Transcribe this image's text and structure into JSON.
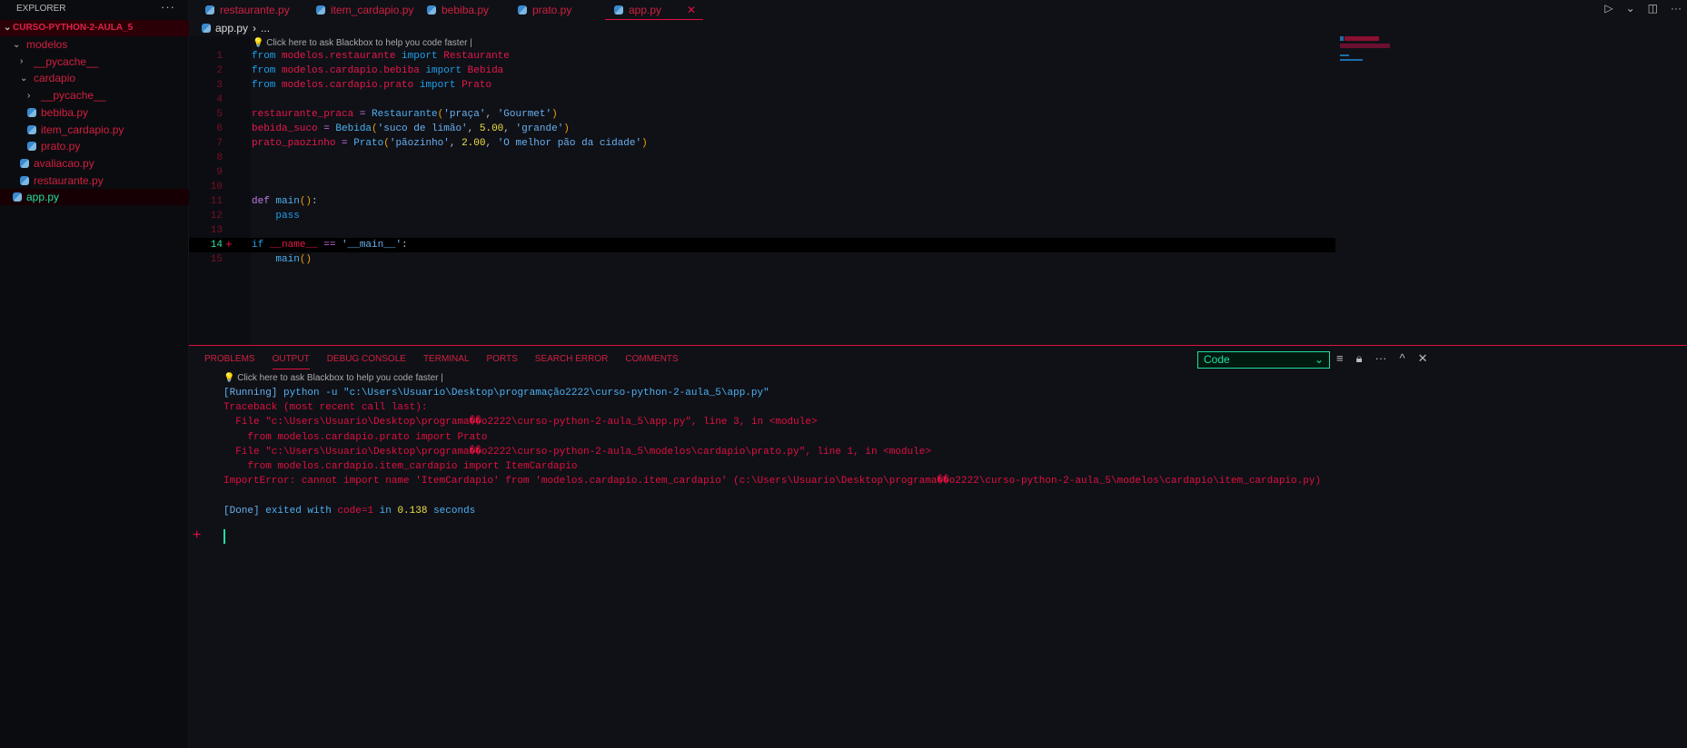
{
  "sidebar": {
    "title": "EXPLORER",
    "more": "···",
    "root": "CURSO-PYTHON-2-AULA_5",
    "items": [
      {
        "label": "modelos",
        "type": "folder-open",
        "depth": 1
      },
      {
        "label": "__pycache__",
        "type": "folder-closed",
        "depth": 2
      },
      {
        "label": "cardapio",
        "type": "folder-open",
        "depth": 2
      },
      {
        "label": "__pycache__",
        "type": "folder-closed",
        "depth": 3
      },
      {
        "label": "bebiba.py",
        "type": "file",
        "depth": 3
      },
      {
        "label": "item_cardapio.py",
        "type": "file",
        "depth": 3
      },
      {
        "label": "prato.py",
        "type": "file",
        "depth": 3
      },
      {
        "label": "avaliacao.py",
        "type": "file",
        "depth": 2
      },
      {
        "label": "restaurante.py",
        "type": "file",
        "depth": 2
      },
      {
        "label": "app.py",
        "type": "file",
        "depth": 1,
        "active": true
      }
    ]
  },
  "tabs": [
    {
      "label": "restaurante.py"
    },
    {
      "label": "item_cardapio.py"
    },
    {
      "label": "bebiba.py"
    },
    {
      "label": "prato.py"
    },
    {
      "label": "app.py",
      "active": true,
      "close": "✕"
    }
  ],
  "breadcrumb": {
    "file": "app.py",
    "sep": "›",
    "rest": "..."
  },
  "blackbox_hint": "Click here to ask Blackbox to help you code faster |",
  "editor": {
    "current_line": 14,
    "lines": [
      [
        {
          "t": "from ",
          "c": "kw"
        },
        {
          "t": "modelos.restaurante ",
          "c": "mod"
        },
        {
          "t": "import ",
          "c": "kw"
        },
        {
          "t": "Restaurante",
          "c": "mod"
        }
      ],
      [
        {
          "t": "from ",
          "c": "kw"
        },
        {
          "t": "modelos.cardapio.bebiba ",
          "c": "mod"
        },
        {
          "t": "import ",
          "c": "kw"
        },
        {
          "t": "Bebida",
          "c": "mod"
        }
      ],
      [
        {
          "t": "from ",
          "c": "kw"
        },
        {
          "t": "modelos.cardapio.prato ",
          "c": "mod"
        },
        {
          "t": "import ",
          "c": "kw"
        },
        {
          "t": "Prato",
          "c": "mod"
        }
      ],
      [],
      [
        {
          "t": "restaurante_praca ",
          "c": "var"
        },
        {
          "t": "= ",
          "c": "op"
        },
        {
          "t": "Restaurante",
          "c": "fn"
        },
        {
          "t": "(",
          "c": "br"
        },
        {
          "t": "'praça'",
          "c": "str"
        },
        {
          "t": ", ",
          "c": "pl"
        },
        {
          "t": "'Gourmet'",
          "c": "str"
        },
        {
          "t": ")",
          "c": "br"
        }
      ],
      [
        {
          "t": "bebida_suco ",
          "c": "var"
        },
        {
          "t": "= ",
          "c": "op"
        },
        {
          "t": "Bebida",
          "c": "fn"
        },
        {
          "t": "(",
          "c": "br"
        },
        {
          "t": "'suco de limão'",
          "c": "str"
        },
        {
          "t": ", ",
          "c": "pl"
        },
        {
          "t": "5.00",
          "c": "num"
        },
        {
          "t": ", ",
          "c": "pl"
        },
        {
          "t": "'grande'",
          "c": "str"
        },
        {
          "t": ")",
          "c": "br"
        }
      ],
      [
        {
          "t": "prato_paozinho ",
          "c": "var"
        },
        {
          "t": "= ",
          "c": "op"
        },
        {
          "t": "Prato",
          "c": "fn"
        },
        {
          "t": "(",
          "c": "br"
        },
        {
          "t": "'pãozinho'",
          "c": "str"
        },
        {
          "t": ", ",
          "c": "pl"
        },
        {
          "t": "2.00",
          "c": "num"
        },
        {
          "t": ", ",
          "c": "pl"
        },
        {
          "t": "'O melhor pão da cidade'",
          "c": "str"
        },
        {
          "t": ")",
          "c": "br"
        }
      ],
      [],
      [],
      [],
      [
        {
          "t": "def ",
          "c": "def"
        },
        {
          "t": "main",
          "c": "fn"
        },
        {
          "t": "()",
          "c": "br"
        },
        {
          "t": ":",
          "c": "pl"
        }
      ],
      [
        {
          "t": "    pass",
          "c": "kw"
        }
      ],
      [],
      [
        {
          "t": "if ",
          "c": "kw"
        },
        {
          "t": "__name__",
          "c": "dun"
        },
        {
          "t": " == ",
          "c": "op"
        },
        {
          "t": "'__main__'",
          "c": "str"
        },
        {
          "t": ":",
          "c": "pl"
        }
      ],
      [
        {
          "t": "    main",
          "c": "fn"
        },
        {
          "t": "()",
          "c": "br"
        }
      ]
    ]
  },
  "panel": {
    "tabs": [
      "PROBLEMS",
      "OUTPUT",
      "DEBUG CONSOLE",
      "TERMINAL",
      "PORTS",
      "SEARCH ERROR",
      "COMMENTS"
    ],
    "active_tab": "OUTPUT",
    "channel": "Code",
    "output": [
      [
        {
          "t": "[Running] ",
          "c": "oblue"
        },
        {
          "t": "python -u \"c:\\Users\\Usuario\\Desktop\\programação2222\\curso-python-2-aula_5\\app.py\"",
          "c": "obr"
        }
      ],
      [
        {
          "t": "Traceback (most recent call last):",
          "c": "ored"
        }
      ],
      [
        {
          "t": "  File \"c:\\Users\\Usuario\\Desktop\\programa��o2222\\curso-python-2-aula_5\\app.py\", line 3, in <module>",
          "c": "ored"
        }
      ],
      [
        {
          "t": "    from modelos.cardapio.prato import Prato",
          "c": "ored"
        }
      ],
      [
        {
          "t": "  File \"c:\\Users\\Usuario\\Desktop\\programa��o2222\\curso-python-2-aula_5\\modelos\\cardapio\\prato.py\", line 1, in <module>",
          "c": "ored"
        }
      ],
      [
        {
          "t": "    from modelos.cardapio.item_cardapio import ItemCardapio",
          "c": "ored"
        }
      ],
      [
        {
          "t": "ImportError: cannot import name 'ItemCardapio' from 'modelos.cardapio.item_cardapio' (c:\\Users\\Usuario\\Desktop\\programa��o2222\\curso-python-2-aula_5\\modelos\\cardapio\\item_cardapio.py)",
          "c": "ored"
        }
      ],
      [],
      [
        {
          "t": "[Done] ",
          "c": "oblue"
        },
        {
          "t": "exited with ",
          "c": "obr"
        },
        {
          "t": "code=1",
          "c": "ored"
        },
        {
          "t": " in ",
          "c": "obr"
        },
        {
          "t": "0.138",
          "c": "oyel"
        },
        {
          "t": " seconds",
          "c": "obr"
        }
      ]
    ]
  },
  "colors": {
    "accent": "#e0103f",
    "active": "#20e0a0",
    "background": "#0f1117"
  }
}
